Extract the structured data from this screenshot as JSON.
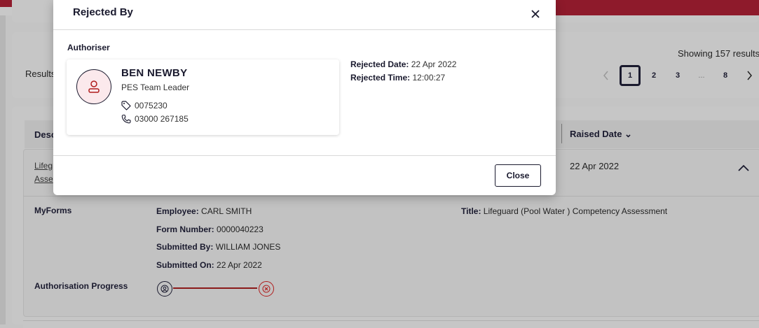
{
  "background": {
    "results_label": "Results",
    "showing_text": "Showing 157 results",
    "pagination": {
      "prev_icon": "chevron-left-icon",
      "pages": [
        "1",
        "2",
        "3",
        "...",
        "8"
      ],
      "active_page": "1",
      "next_icon": "chevron-right-icon"
    },
    "table": {
      "header_description": "Desc",
      "header_raised_date": "Raised Date ⌄",
      "row": {
        "description_line1": "Lifeg",
        "description_line2": "Asse",
        "raised_date": "22 Apr 2022",
        "expand_icon": "chevron-up-icon"
      }
    },
    "details": {
      "section_label": "MyForms",
      "employee_label": "Employee:",
      "employee_value": "CARL SMITH",
      "form_number_label": "Form Number:",
      "form_number_value": "0000040223",
      "submitted_by_label": "Submitted By:",
      "submitted_by_value": "WILLIAM JONES",
      "submitted_on_label": "Submitted On:",
      "submitted_on_value": "22 Apr 2022",
      "title_label": "Title:",
      "title_value": "Lifeguard (Pool Water ) Competency Assessment",
      "progress_label": "Authorisation Progress"
    }
  },
  "modal": {
    "title": "Rejected By",
    "close_icon": "close-icon",
    "section_label": "Authoriser",
    "authoriser": {
      "name": "BEN NEWBY",
      "role": "PES Team Leader",
      "employee_id": "0075230",
      "phone": "03000 267185"
    },
    "rejected_date_label": "Rejected Date:",
    "rejected_date_value": " 22 Apr 2022",
    "rejected_time_label": "Rejected Time:",
    "rejected_time_value": " 12:00:27",
    "close_button_label": "Close"
  },
  "colors": {
    "brand_red": "#8e1a2b",
    "navy": "#1a1a2e",
    "reject_red": "#b01c1c",
    "avatar_bg": "#fbe9ec"
  }
}
